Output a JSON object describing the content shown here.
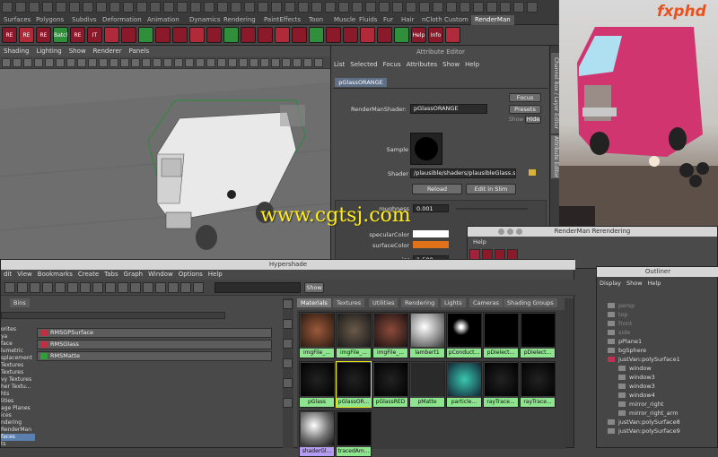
{
  "shelf_tabs": [
    "Surfaces",
    "Polygons",
    "Subdivs",
    "Deformation",
    "Animation",
    "Dynamics",
    "Rendering",
    "PaintEffects",
    "Toon",
    "Muscle",
    "Fluids",
    "Fur",
    "Hair",
    "nCloth",
    "Custom",
    "RenderMan"
  ],
  "shelf_icons": [
    "RE",
    "RE",
    "RE",
    "Batch",
    "RE",
    "IT",
    "",
    "",
    "",
    "",
    "",
    "",
    "",
    "",
    "",
    "",
    "",
    "",
    "",
    "",
    "",
    "",
    "",
    "",
    "Help",
    "Info",
    ""
  ],
  "viewport": {
    "menu": [
      "Shading",
      "Lighting",
      "Show",
      "Renderer",
      "Panels"
    ]
  },
  "attribute_editor": {
    "title": "Attribute Editor",
    "menu": [
      "List",
      "Selected",
      "Focus",
      "Attributes",
      "Show",
      "Help"
    ],
    "node_tab": "pGlassORANGE",
    "shader_label": "RenderManShader:",
    "shader_value": "pGlassORANGE",
    "focus": "Focus",
    "presets": "Presets",
    "show": "Show",
    "hide": "Hide",
    "sample_label": "Sample",
    "shader_path_label": "Shader",
    "shader_path": "/plausible/shaders/plausibleGlass.slo",
    "reload": "Reload",
    "edit_slim": "Edit in Slim",
    "roughness_label": "roughness",
    "roughness_value": "0.001",
    "specular_label": "specularColor",
    "surface_label": "surfaceColor",
    "ior_label": "ior",
    "ior_value": "1.500",
    "surface_color": "#e0731a"
  },
  "channel_tabs": [
    "Channel Box / Layer Editor",
    "Attribute Editor"
  ],
  "rerendering": {
    "title": "RenderMan Rerendering",
    "menu": "Help"
  },
  "hypershade": {
    "title": "Hypershade",
    "menu": [
      "dit",
      "View",
      "Bookmarks",
      "Create",
      "Tabs",
      "Graph",
      "Window",
      "Options",
      "Help"
    ],
    "show_button": "Show",
    "bins_tab": "Bins",
    "tree": [
      "orites",
      "ya",
      "face",
      "lumetric",
      "splacement",
      "Textures",
      "Textures",
      "vy Textures",
      "her Textu...",
      "hts",
      "lities",
      "age Planes",
      "ices",
      "ndering",
      "RenderMan",
      "faces",
      "ts"
    ],
    "tree_selected": 15,
    "shader_nodes": [
      "RMSGPSurface",
      "RMSGlass",
      "RMSMatte"
    ],
    "tabs": [
      "Materials",
      "Textures",
      "Utilities",
      "Rendering",
      "Lights",
      "Cameras",
      "Shading Groups"
    ],
    "swatches": [
      "imgFile_...",
      "imgFile_...",
      "imgFile_...",
      "lambert1",
      "pConduct...",
      "pDielect...",
      "pDielect...",
      "pGlass",
      "pGlassOR...",
      "pGlassRED",
      "pMatte",
      "particle...",
      "rayTrace...",
      "rayTrace...",
      "shaderGl...",
      "tracedAm..."
    ]
  },
  "outliner": {
    "title": "Outliner",
    "menu": [
      "Display",
      "Show",
      "Help"
    ],
    "items": [
      "persp",
      "top",
      "front",
      "side",
      "pPlane1",
      "bgSphere",
      "justVan:polySurface1",
      "window",
      "window3",
      "window3",
      "window4",
      "mirror_right",
      "mirror_right_arm",
      "justVan:polySurface8",
      "justVan:polySurface9"
    ]
  },
  "watermark": "www.cgtsj.com",
  "fxphd": "fxphd",
  "colors": {
    "swatch_label": "#8fe48f",
    "selected": "#5a7fb0",
    "shelf_red": "#8a1a2a"
  }
}
